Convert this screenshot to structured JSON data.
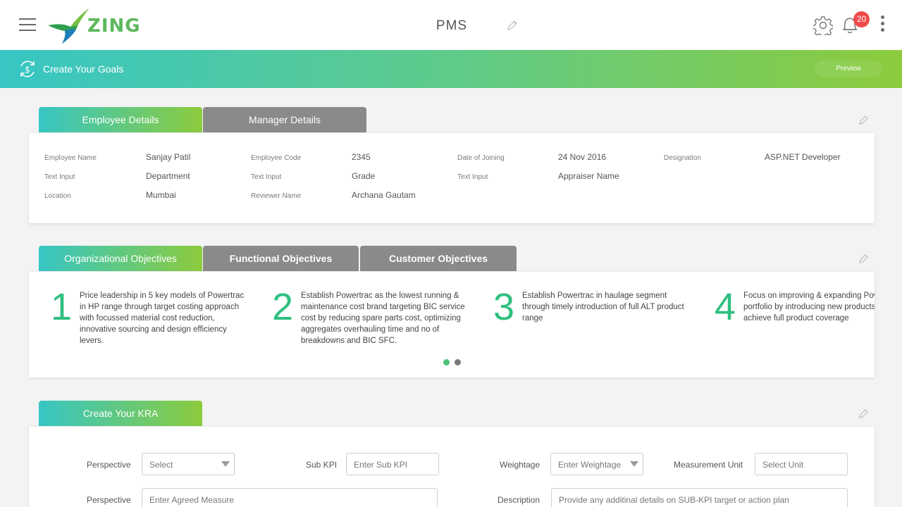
{
  "header": {
    "logo_text": "ZING",
    "title": "PMS",
    "notification_count": "20"
  },
  "banner": {
    "title": "Create Your Goals",
    "preview_label": "Preview"
  },
  "employee_tabs": [
    "Employee Details",
    "Manager Details"
  ],
  "employee_details": [
    {
      "label": "Employee Name",
      "value": "Sanjay Patil"
    },
    {
      "label": "Employee Code",
      "value": "2345"
    },
    {
      "label": "Date of Joining",
      "value": "24 Nov 2016"
    },
    {
      "label": "Designation",
      "value": "ASP.NET Developer"
    },
    {
      "label": "Text Input",
      "value": "Department"
    },
    {
      "label": "Text Input",
      "value": "Grade"
    },
    {
      "label": "Text Input",
      "value": "Appraiser Name"
    },
    {
      "label": "Location",
      "value": "Mumbai"
    },
    {
      "label": "Reviewer Name",
      "value": "Archana Gautam"
    }
  ],
  "objective_tabs": [
    "Organizational Objectives",
    "Functional Objectives",
    "Customer Objectives"
  ],
  "objectives": [
    {
      "num": "1",
      "text": "Price leadership in 5 key models of Powertrac in HP range through target costing approach with focussed material cost reduction, innovative sourcing and design efficiency levers."
    },
    {
      "num": "2",
      "text": "Establish Powertrac as the lowest running & maintenance cost brand targeting BIC service cost by reducing spare parts cost, optimizing aggregates overhauling time and no of breakdowns and BIC SFC."
    },
    {
      "num": "3",
      "text": "Establish Powertrac in haulage segment through timely introduction of full ALT product range"
    },
    {
      "num": "4",
      "text": "Focus on improving & expanding Powertrac portfolio by introducing new products to achieve full product coverage"
    }
  ],
  "colors": {
    "accent_green": "#2fbf7f",
    "dot_active": "#4fc07a",
    "dot_inactive": "#7a7a7a",
    "badge": "#f04b4b"
  },
  "kra": {
    "tab": "Create Your KRA",
    "perspective_label": "Perspective",
    "perspective_select": "Select",
    "sub_kpi_label": "Sub KPI",
    "sub_kpi_placeholder": "Enter Sub KPI",
    "weightage_label": "Weightage",
    "weightage_placeholder": "Enter Weightage",
    "measurement_label": "Measurement Unit",
    "measurement_placeholder": "Select Unit",
    "perspective2_label": "Perspective",
    "agreed_measure_placeholder": "Enter Agreed Measure",
    "description_label": "Description",
    "description_placeholder": "Provide any additinal details on SUB-KPI target or action plan"
  }
}
